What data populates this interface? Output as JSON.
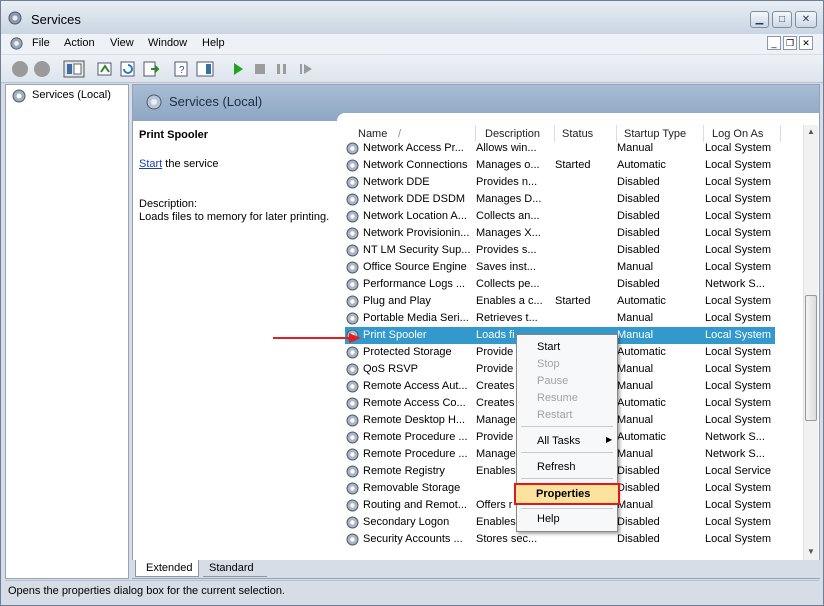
{
  "window": {
    "title": "Services"
  },
  "menu": [
    "File",
    "Action",
    "View",
    "Window",
    "Help"
  ],
  "tree": {
    "root_label": "Services (Local)"
  },
  "content": {
    "header_title": "Services (Local)"
  },
  "description_panel": {
    "service_name": "Print Spooler",
    "action_link": "Start",
    "action_suffix": " the service",
    "description_label": "Description:",
    "description_text": "Loads files to memory for later printing."
  },
  "grid": {
    "columns": [
      "Name",
      "Description",
      "Status",
      "Startup Type",
      "Log On As"
    ],
    "sort_indicator": "/",
    "rows": [
      [
        "Network Access Pr...",
        "Allows win...",
        "",
        "Manual",
        "Local System"
      ],
      [
        "Network Connections",
        "Manages o...",
        "Started",
        "Automatic",
        "Local System"
      ],
      [
        "Network DDE",
        "Provides n...",
        "",
        "Disabled",
        "Local System"
      ],
      [
        "Network DDE DSDM",
        "Manages D...",
        "",
        "Disabled",
        "Local System"
      ],
      [
        "Network Location A...",
        "Collects an...",
        "",
        "Disabled",
        "Local System"
      ],
      [
        "Network Provisionin...",
        "Manages X...",
        "",
        "Disabled",
        "Local System"
      ],
      [
        "NT LM Security Sup...",
        "Provides s...",
        "",
        "Disabled",
        "Local System"
      ],
      [
        "Office Source Engine",
        "Saves inst...",
        "",
        "Manual",
        "Local System"
      ],
      [
        "Performance Logs ...",
        "Collects pe...",
        "",
        "Disabled",
        "Network S..."
      ],
      [
        "Plug and Play",
        "Enables a c...",
        "Started",
        "Automatic",
        "Local System"
      ],
      [
        "Portable Media Seri...",
        "Retrieves t...",
        "",
        "Manual",
        "Local System"
      ],
      [
        "Print Spooler",
        "Loads fi",
        "",
        "Manual",
        "Local System"
      ],
      [
        "Protected Storage",
        "Provide",
        "",
        "Automatic",
        "Local System"
      ],
      [
        "QoS RSVP",
        "Provide",
        "",
        "Manual",
        "Local System"
      ],
      [
        "Remote Access Aut...",
        "Creates",
        "",
        "Manual",
        "Local System"
      ],
      [
        "Remote Access Co...",
        "Creates",
        "",
        "Automatic",
        "Local System"
      ],
      [
        "Remote Desktop H...",
        "Manage",
        "",
        "Manual",
        "Local System"
      ],
      [
        "Remote Procedure ...",
        "Provide",
        "",
        "Automatic",
        "Network S..."
      ],
      [
        "Remote Procedure ...",
        "Manage",
        "",
        "Manual",
        "Network S..."
      ],
      [
        "Remote Registry",
        "Enables",
        "",
        "Disabled",
        "Local Service"
      ],
      [
        "Removable Storage",
        "",
        "",
        "Disabled",
        "Local System"
      ],
      [
        "Routing and Remot...",
        "Offers r",
        "",
        "Manual",
        "Local System"
      ],
      [
        "Secondary Logon",
        "Enables",
        "",
        "Disabled",
        "Local System"
      ],
      [
        "Security Accounts ...",
        "Stores sec...",
        "",
        "Disabled",
        "Local System"
      ]
    ],
    "selected_index": 11
  },
  "context_menu": {
    "items": [
      {
        "label": "Start",
        "enabled": true
      },
      {
        "label": "Stop",
        "enabled": false
      },
      {
        "label": "Pause",
        "enabled": false
      },
      {
        "label": "Resume",
        "enabled": false
      },
      {
        "label": "Restart",
        "enabled": false
      },
      {
        "label": "All Tasks",
        "enabled": true
      },
      {
        "label": "Refresh",
        "enabled": true
      },
      {
        "label": "Properties",
        "enabled": true
      },
      {
        "label": "Help",
        "enabled": true
      }
    ],
    "highlighted": "Properties"
  },
  "tabs": [
    "Extended",
    "Standard"
  ],
  "status_bar": {
    "text": "Opens the properties dialog box for the current selection."
  },
  "colors": {
    "selection": "#3399cc",
    "annotation_red": "#e02020",
    "header_blue": "#9bb3cf"
  }
}
